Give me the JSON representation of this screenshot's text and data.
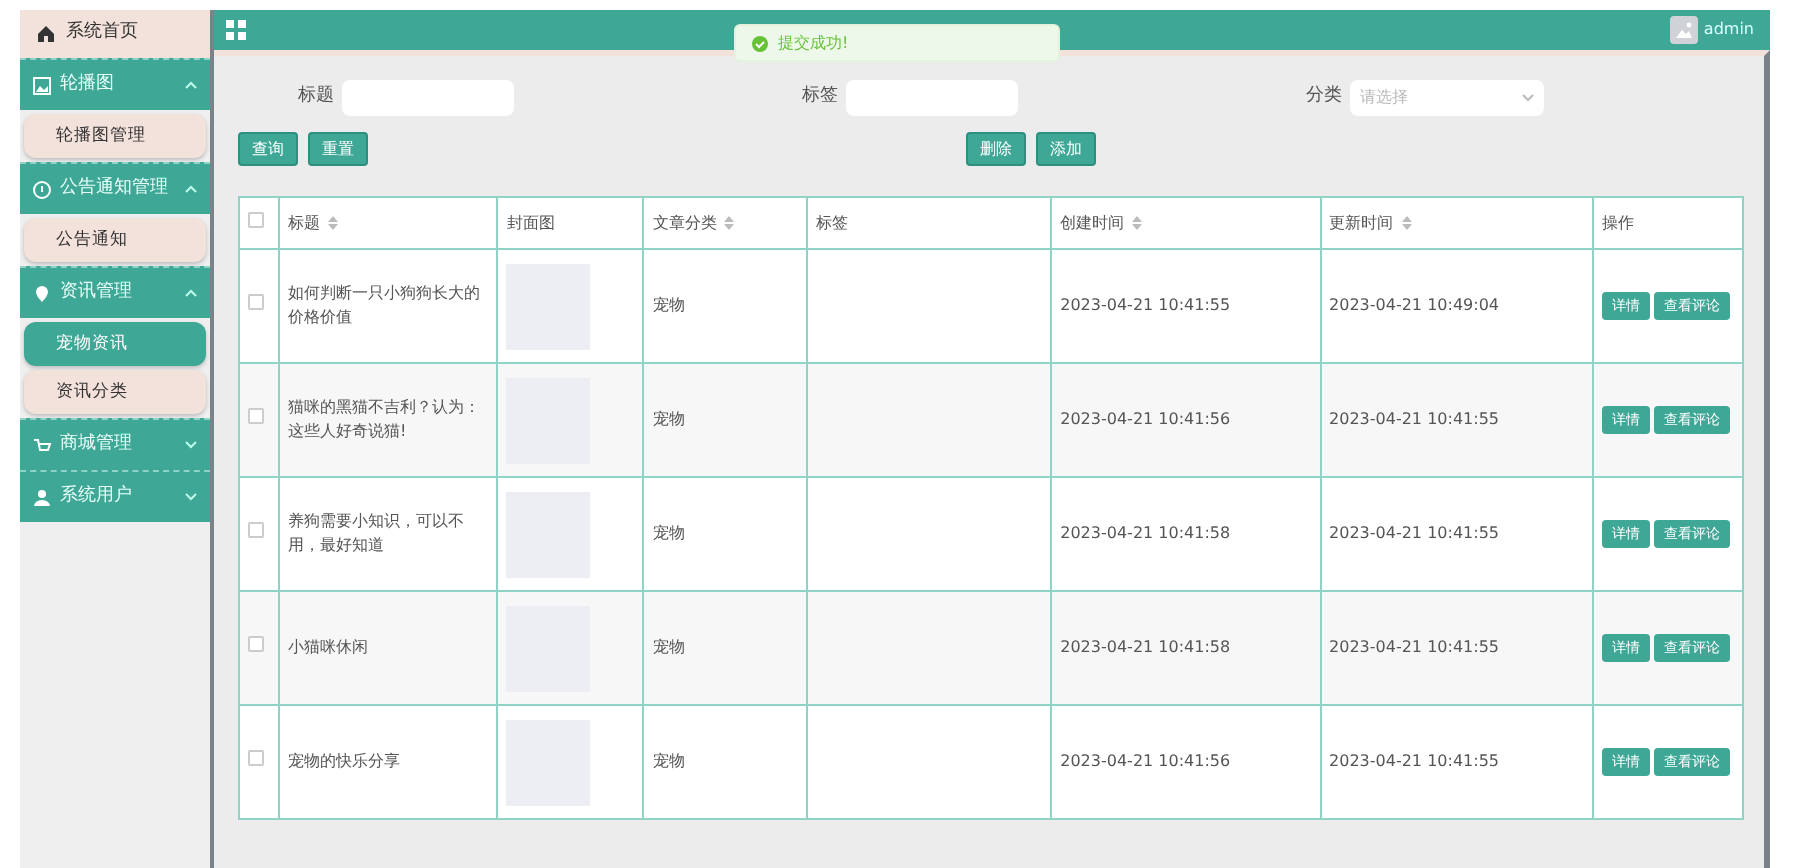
{
  "sidebar": {
    "items": [
      {
        "kind": "link",
        "label": "系统首页"
      },
      {
        "kind": "group",
        "label": "轮播图",
        "expanded": true,
        "children": [
          {
            "label": "轮播图管理",
            "selected": false
          }
        ]
      },
      {
        "kind": "group",
        "label": "公告通知管理",
        "expanded": true,
        "children": [
          {
            "label": "公告通知",
            "selected": false
          }
        ]
      },
      {
        "kind": "group",
        "label": "资讯管理",
        "expanded": true,
        "children": [
          {
            "label": "宠物资讯",
            "selected": true
          },
          {
            "label": "资讯分类",
            "selected": false
          }
        ]
      },
      {
        "kind": "group",
        "label": "商城管理",
        "expanded": false
      },
      {
        "kind": "group",
        "label": "系统用户",
        "expanded": false
      }
    ]
  },
  "topbar": {
    "user": "admin"
  },
  "toast": {
    "message": "提交成功!"
  },
  "filters": [
    {
      "kind": "text",
      "label": "标题"
    },
    {
      "kind": "text",
      "label": "标签"
    },
    {
      "kind": "select",
      "label": "分类",
      "placeholder": "请选择"
    }
  ],
  "search_buttons": [
    "查询",
    "重置"
  ],
  "action_buttons": [
    "删除",
    "添加"
  ],
  "table": {
    "select_all_checked": false,
    "columns": [
      {
        "kind": "checkbox"
      },
      {
        "kind": "text",
        "label": "标题",
        "sortable": true
      },
      {
        "kind": "text",
        "label": "封面图",
        "sortable": false
      },
      {
        "kind": "text",
        "label": "文章分类",
        "sortable": true
      },
      {
        "kind": "text",
        "label": "标签",
        "sortable": false
      },
      {
        "kind": "text",
        "label": "创建时间",
        "sortable": true
      },
      {
        "kind": "text",
        "label": "更新时间",
        "sortable": true
      },
      {
        "kind": "text",
        "label": "操作",
        "sortable": false
      }
    ],
    "rows": [
      {
        "checked": false,
        "title": "如何判断一只小狗狗长大的价格价值",
        "category": "宠物",
        "created": "2023-04-21 10:41:55",
        "updated": "2023-04-21 10:49:04",
        "actions": [
          "详情",
          "查看评论"
        ]
      },
      {
        "checked": false,
        "title": "猫咪的黑猫不吉利？认为：这些人好奇说猫!",
        "category": "宠物",
        "created": "2023-04-21 10:41:56",
        "updated": "2023-04-21 10:41:55",
        "actions": [
          "详情",
          "查看评论"
        ]
      },
      {
        "checked": false,
        "title": "养狗需要小知识，可以不用，最好知道",
        "category": "宠物",
        "created": "2023-04-21 10:41:58",
        "updated": "2023-04-21 10:41:55",
        "actions": [
          "详情",
          "查看评论"
        ]
      },
      {
        "checked": false,
        "title": "小猫咪休闲",
        "category": "宠物",
        "created": "2023-04-21 10:41:58",
        "updated": "2023-04-21 10:41:55",
        "actions": [
          "详情",
          "查看评论"
        ]
      },
      {
        "checked": false,
        "title": "宠物的快乐分享",
        "category": "宠物",
        "created": "2023-04-21 10:41:56",
        "updated": "2023-04-21 10:41:55",
        "actions": [
          "详情",
          "查看评论"
        ]
      }
    ]
  }
}
